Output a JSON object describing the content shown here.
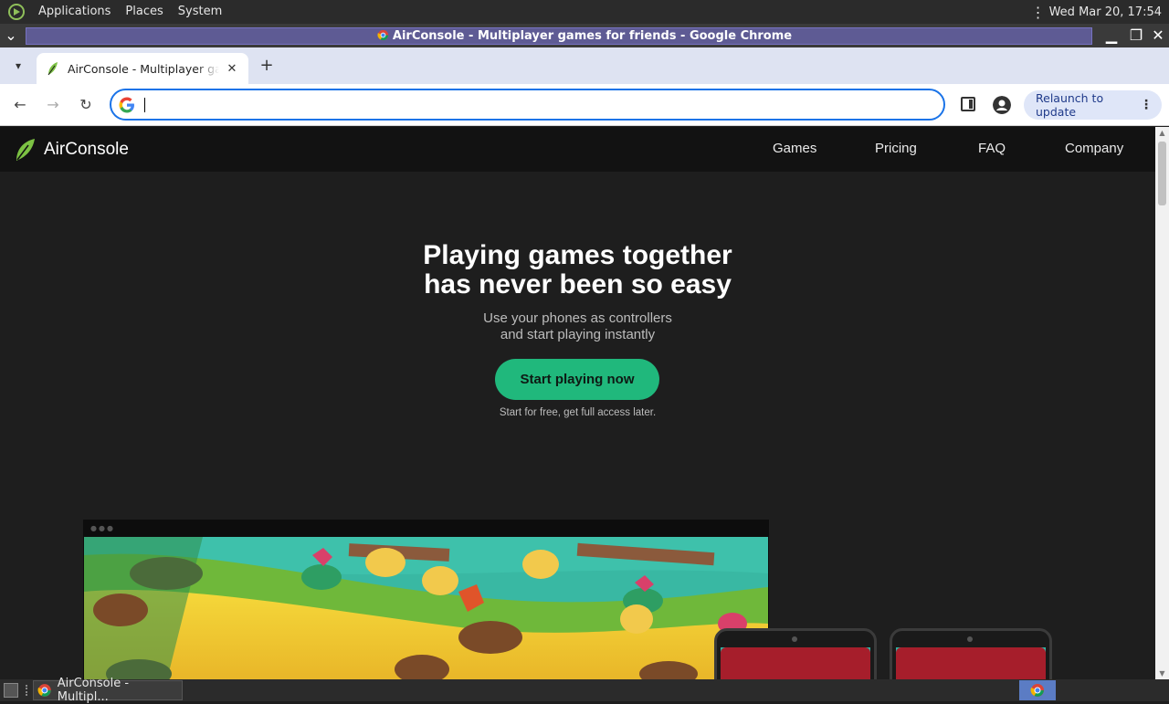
{
  "system_panel": {
    "menus": [
      "Applications",
      "Places",
      "System"
    ],
    "clock": "Wed Mar 20, 17:54"
  },
  "window": {
    "title": "AirConsole - Multiplayer games for friends - Google Chrome"
  },
  "browser": {
    "tab_title": "AirConsole - Multiplayer games for friends",
    "omnibox_value": "",
    "relaunch_label": "Relaunch to update"
  },
  "site": {
    "brand": "AirConsole",
    "nav": [
      "Games",
      "Pricing",
      "FAQ",
      "Company"
    ],
    "hero_title_line1": "Playing games together",
    "hero_title_line2": "has never been so easy",
    "hero_sub_line1": "Use your phones as controllers",
    "hero_sub_line2": "and start playing instantly",
    "cta_label": "Start playing now",
    "cta_note": "Start for free, get full access later."
  },
  "taskbar": {
    "task_label": "AirConsole - Multipl..."
  },
  "colors": {
    "accent_green": "#20b87c",
    "omnibox_border": "#1a73e8",
    "site_bg": "#1e1e1e"
  },
  "icons": [
    "gnome-foot-icon",
    "chrome-icon",
    "airconsole-leaf-icon",
    "google-g-icon",
    "back-icon",
    "forward-icon",
    "reload-icon",
    "side-panel-icon",
    "profile-icon",
    "kebab-icon",
    "close-icon",
    "minimize-icon",
    "maximize-icon"
  ]
}
